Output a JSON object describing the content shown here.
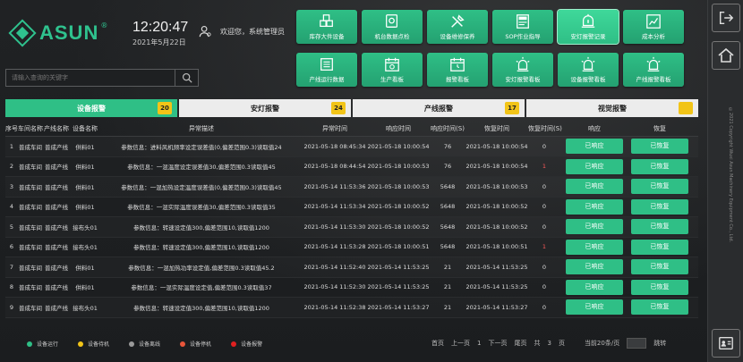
{
  "brand": {
    "name": "ASUN",
    "reg": "®"
  },
  "clock": {
    "time": "12:20:47",
    "date": "2021年5月22日"
  },
  "user": {
    "name": "欢迎您，系统管理员"
  },
  "menu_top": [
    {
      "label": "库存大件设备",
      "icon": "boxes-icon"
    },
    {
      "label": "机台数据点检",
      "icon": "machine-check-icon"
    },
    {
      "label": "设备维修保养",
      "icon": "tools-icon"
    },
    {
      "label": "SOP作业指导",
      "icon": "sop-doc-icon"
    },
    {
      "label": "安灯报警记录",
      "icon": "alarm-bell-icon"
    },
    {
      "label": "成本分析",
      "icon": "chart-icon"
    }
  ],
  "menu_bottom": [
    {
      "label": "产线运行数据",
      "icon": "production-line-icon"
    },
    {
      "label": "生产看板",
      "icon": "calendar-board-icon"
    },
    {
      "label": "报警看板",
      "icon": "calendar-alarm-icon"
    },
    {
      "label": "安灯报警看板",
      "icon": "andon-icon"
    },
    {
      "label": "设备报警看板",
      "icon": "device-alarm-icon"
    },
    {
      "label": "产线报警看板",
      "icon": "line-alarm-icon"
    }
  ],
  "search": {
    "placeholder": "请输入查询的关键字"
  },
  "tabs": [
    {
      "label": "设备报警",
      "count": "20"
    },
    {
      "label": "安灯报警",
      "count": "24"
    },
    {
      "label": "产线报警",
      "count": "17"
    },
    {
      "label": "视觉报警",
      "count": ""
    }
  ],
  "table": {
    "headers": [
      "序号",
      "车间名称",
      "产线名称",
      "设备名称",
      "异常描述",
      "异常时间",
      "响应时间",
      "响应时间(S)",
      "恢复时间",
      "恢复时间(S)",
      "响应",
      "恢复"
    ],
    "rows": [
      [
        "1",
        "普成车间",
        "普成产线",
        "供料01",
        "参数信息：进料风机频率设定误差值(0,偏差范围0.3)读取值24",
        "2021-05-18 08:45:34",
        "2021-05-18 10:00:54",
        "76",
        "2021-05-18 10:00:54",
        "0",
        "已响应",
        "已恢复"
      ],
      [
        "2",
        "普成车间",
        "普成产线",
        "供料01",
        "参数信息：一混温度设定误差值30,偏差范围0.3读取值45",
        "2021-05-18 08:44:54",
        "2021-05-18 10:00:53",
        "76",
        "2021-05-18 10:00:54",
        "1",
        "已响应",
        "已恢复"
      ],
      [
        "3",
        "普成车间",
        "普成产线",
        "供料01",
        "参数信息：一混加热设定温度误差值(0,偏差范围0.3)读取值45",
        "2021-05-14 11:53:36",
        "2021-05-18 10:00:53",
        "5648",
        "2021-05-18 10:00:53",
        "0",
        "已响应",
        "已恢复"
      ],
      [
        "4",
        "普成车间",
        "普成产线",
        "供料01",
        "参数信息：一混实际温度误差值30,偏差范围0.3读取值35",
        "2021-05-14 11:53:34",
        "2021-05-18 10:00:52",
        "5648",
        "2021-05-18 10:00:52",
        "0",
        "已响应",
        "已恢复"
      ],
      [
        "5",
        "普成车间",
        "普成产线",
        "接布头01",
        "参数信息：转速设定值300,偏差范围10,读取值1200",
        "2021-05-14 11:53:30",
        "2021-05-18 10:00:52",
        "5648",
        "2021-05-18 10:00:52",
        "0",
        "已响应",
        "已恢复"
      ],
      [
        "6",
        "普成车间",
        "普成产线",
        "接布头01",
        "参数信息：转速设定值300,偏差范围10,读取值1200",
        "2021-05-14 11:53:28",
        "2021-05-18 10:00:51",
        "5648",
        "2021-05-18 10:00:51",
        "1",
        "已响应",
        "已恢复"
      ],
      [
        "7",
        "普成车间",
        "普成产线",
        "供料01",
        "参数信息：一混加热功率设定值,偏差范围0.3读取值45.2",
        "2021-05-14 11:52:40",
        "2021-05-14 11:53:25",
        "21",
        "2021-05-14 11:53:25",
        "0",
        "已响应",
        "已恢复"
      ],
      [
        "8",
        "普成车间",
        "普成产线",
        "供料01",
        "参数信息：一混实际温度设定值,偏差范围0.3读取值37",
        "2021-05-14 11:52:30",
        "2021-05-14 11:53:25",
        "21",
        "2021-05-14 11:53:25",
        "0",
        "已响应",
        "已恢复"
      ],
      [
        "9",
        "普成车间",
        "普成产线",
        "接布头01",
        "参数信息：转速设定值300,偏差范围10,读取值1200",
        "2021-05-14 11:52:38",
        "2021-05-14 11:53:27",
        "21",
        "2021-05-14 11:53:27",
        "0",
        "已响应",
        "已恢复"
      ]
    ],
    "red_rows": [
      2,
      3,
      6
    ]
  },
  "legend": [
    {
      "label": "设备运行",
      "color": "#2fbf86"
    },
    {
      "label": "设备待机",
      "color": "#f2c418"
    },
    {
      "label": "设备离线",
      "color": "#9a9a9a"
    },
    {
      "label": "设备停机",
      "color": "#e8553a"
    },
    {
      "label": "设备报警",
      "color": "#e02020"
    }
  ],
  "pager": {
    "first": "首页",
    "prev": "上一页",
    "page": "1",
    "next": "下一页",
    "last": "尾页",
    "total_label": "共",
    "total_pages": "3",
    "unit": "页",
    "size_label": "当前20条/页",
    "goto": "跳转"
  },
  "rail": {
    "copyright": "©2021 Copyright Wuxi Asun Machinery Equipment Co., Ltd."
  }
}
